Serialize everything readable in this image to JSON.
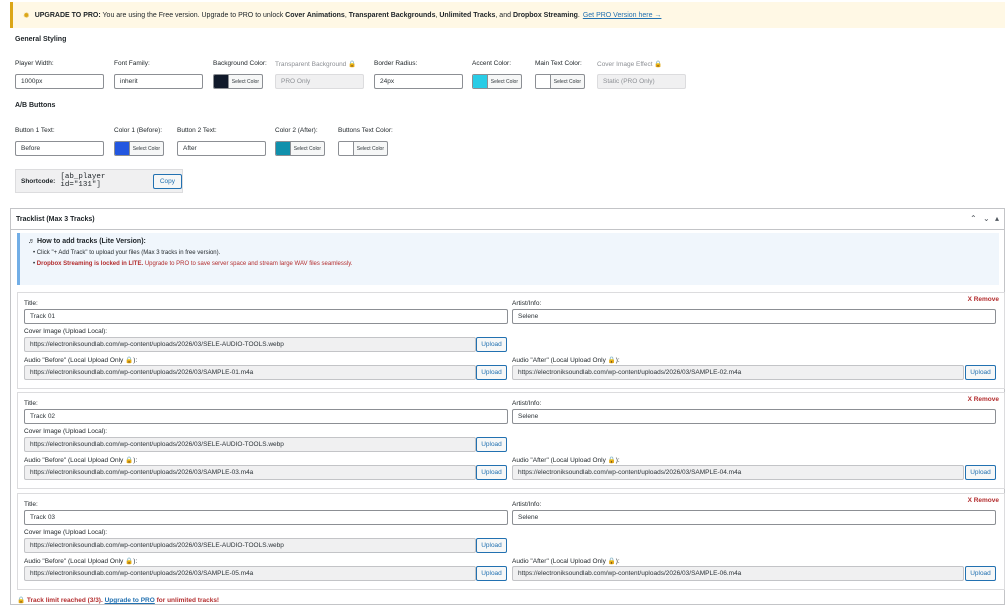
{
  "notice": {
    "prefix": "UPGRADE TO PRO:",
    "text1": "You are using the Free version. Upgrade to PRO to unlock",
    "f1": "Cover Animations",
    "sep1": ",",
    "f2": "Transparent Backgrounds",
    "sep2": ",",
    "f3": "Unlimited Tracks",
    "sep3": ", and",
    "f4": "Dropbox Streaming",
    "sep4": ".",
    "link": "Get PRO Version here →"
  },
  "general": {
    "title": "General Styling",
    "player_width": {
      "label": "Player Width:",
      "value": "1000px"
    },
    "font_family": {
      "label": "Font Family:",
      "value": "inherit"
    },
    "bg_color": {
      "label": "Background Color:",
      "btn": "Select Color",
      "color": "#111a2b"
    },
    "transparent_bg": {
      "label": "Transparent Background",
      "value": "PRO Only"
    },
    "border_radius": {
      "label": "Border Radius:",
      "value": "24px"
    },
    "accent_color": {
      "label": "Accent Color:",
      "btn": "Select Color",
      "color": "#29cce6"
    },
    "main_text_color": {
      "label": "Main Text Color:",
      "btn": "Select Color",
      "color": "#ffffff"
    },
    "cover_effect": {
      "label": "Cover Image Effect",
      "value": "Static (PRO Only)"
    }
  },
  "ab": {
    "title": "A/B Buttons",
    "button1": {
      "label": "Button 1 Text:",
      "value": "Before"
    },
    "color1": {
      "label": "Color 1 (Before):",
      "btn": "Select Color",
      "color": "#2357e0"
    },
    "button2": {
      "label": "Button 2 Text:",
      "value": "After"
    },
    "color2": {
      "label": "Color 2 (After):",
      "btn": "Select Color",
      "color": "#1090ac"
    },
    "btn_text_color": {
      "label": "Buttons Text Color:",
      "btn": "Select Color",
      "color": "#ffffff"
    }
  },
  "shortcode": {
    "label": "Shortcode:",
    "code": "[ab_player id=\"131\"]",
    "copy": "Copy"
  },
  "tracklist": {
    "title": "Tracklist (Max 3 Tracks)",
    "help_title": "How to add tracks (Lite Version):",
    "help_1": "Click \"+ Add Track\" to upload your files (Max 3 tracks in free version).",
    "help_2_bold": "Dropbox Streaming is locked in LITE.",
    "help_2_rest": "Upgrade to PRO to save server space and stream large WAV files seamlessly.",
    "labels": {
      "title": "Title:",
      "artist": "Artist/Info:",
      "cover": "Cover Image (Upload Local):",
      "before": "Audio \"Before\" (Local Upload Only",
      "after": "Audio \"After\" (Local Upload Only",
      "upload": "Upload",
      "remove": "X Remove",
      "close_paren": "):"
    },
    "tracks": [
      {
        "title": "Track 01",
        "artist": "Selene",
        "cover": "https://electroniksoundlab.com/wp-content/uploads/2026/03/SELE-AUDIO-TOOLS.webp",
        "before": "https://electroniksoundlab.com/wp-content/uploads/2026/03/SAMPLE-01.m4a",
        "after": "https://electroniksoundlab.com/wp-content/uploads/2026/03/SAMPLE-02.m4a"
      },
      {
        "title": "Track 02",
        "artist": "Selene",
        "cover": "https://electroniksoundlab.com/wp-content/uploads/2026/03/SELE-AUDIO-TOOLS.webp",
        "before": "https://electroniksoundlab.com/wp-content/uploads/2026/03/SAMPLE-03.m4a",
        "after": "https://electroniksoundlab.com/wp-content/uploads/2026/03/SAMPLE-04.m4a"
      },
      {
        "title": "Track 03",
        "artist": "Selene",
        "cover": "https://electroniksoundlab.com/wp-content/uploads/2026/03/SELE-AUDIO-TOOLS.webp",
        "before": "https://electroniksoundlab.com/wp-content/uploads/2026/03/SAMPLE-05.m4a",
        "after": "https://electroniksoundlab.com/wp-content/uploads/2026/03/SAMPLE-06.m4a"
      }
    ],
    "limit_text": "Track limit reached (3/3).",
    "limit_link": "Upgrade to PRO",
    "limit_rest": "for unlimited tracks!"
  },
  "icons": {
    "star": "star-icon",
    "lock": "lock-icon",
    "music": "music-note-icon",
    "chevrons": [
      "chevron-up-icon",
      "chevron-down-icon",
      "caret-up-icon"
    ]
  }
}
